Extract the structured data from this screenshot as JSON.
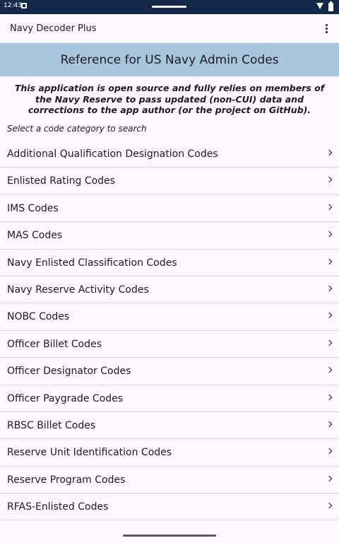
{
  "status": {
    "time": "12:43"
  },
  "appbar": {
    "title": "Navy Decoder Plus"
  },
  "banner": {
    "title": "Reference for US Navy Admin Codes"
  },
  "notice": "This application is open source and fully relies on members of the Navy Reserve to pass updated (non-CUI) data and corrections to the app author (or the project on GitHub).",
  "prompt": "Select a code category to search",
  "categories": [
    "Additional Qualification Designation Codes",
    "Enlisted Rating Codes",
    "IMS Codes",
    "MAS Codes",
    "Navy Enlisted Classification Codes",
    "Navy Reserve Activity Codes",
    "NOBC Codes",
    "Officer Billet Codes",
    "Officer Designator Codes",
    "Officer Paygrade Codes",
    "RBSC Billet Codes",
    "Reserve Unit Identification Codes",
    "Reserve Program Codes",
    "RFAS-Enlisted Codes"
  ],
  "colors": {
    "statusbar": "#152a4a",
    "banner": "#a7c6de",
    "background": "#fdf7ff"
  },
  "icons": {
    "menu": "more-vert-icon",
    "row": "chevron-right-icon"
  }
}
